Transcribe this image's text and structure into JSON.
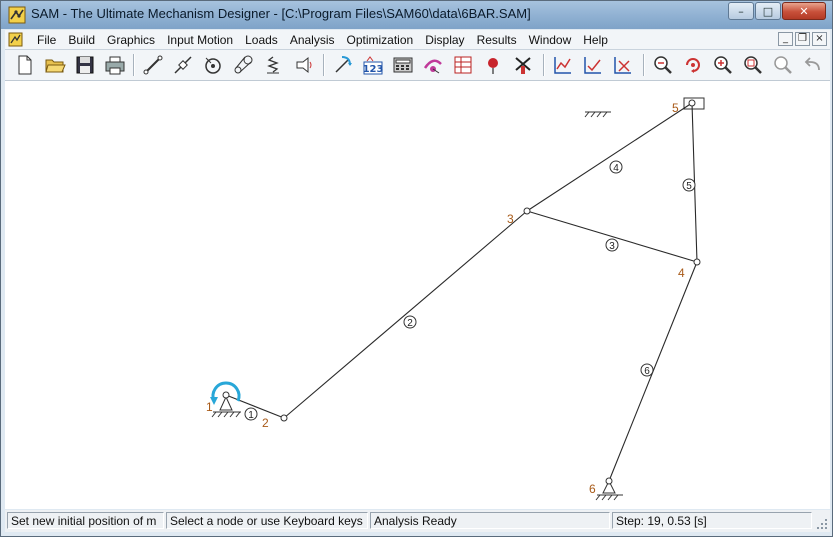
{
  "window": {
    "title": "SAM - The Ultimate Mechanism Designer - [C:\\Program Files\\SAM60\\data\\6BAR.SAM]",
    "caption_buttons": {
      "minimize": "–",
      "maximize": "□",
      "close": "✕"
    }
  },
  "menubar": {
    "items": [
      "File",
      "Build",
      "Graphics",
      "Input Motion",
      "Loads",
      "Analysis",
      "Optimization",
      "Display",
      "Results",
      "Window",
      "Help"
    ],
    "mdi_buttons": {
      "minimize": "_",
      "restore": "❐",
      "close": "×"
    }
  },
  "toolbar": {
    "buttons": [
      "new-file-icon",
      "open-folder-icon",
      "save-disk-icon",
      "print-icon",
      "beam-element-icon",
      "slider-element-icon",
      "gear-element-icon",
      "belt-element-icon",
      "spring-element-icon",
      "damper-element-icon",
      "input-motion-icon",
      "numeric-input-icon",
      "calculator-icon",
      "path-tracer-icon",
      "table-icon",
      "pin-marker-icon",
      "windmill-icon",
      "graph-xy-icon",
      "graph-check-icon",
      "graph-cross-icon",
      "zoom-out-icon",
      "zoom-rotate-icon",
      "zoom-in-icon",
      "zoom-window-icon",
      "zoom-fit-icon",
      "undo-icon"
    ]
  },
  "mechanism": {
    "node_labels": [
      "1",
      "2",
      "3",
      "4",
      "5",
      "6"
    ],
    "link_labels": [
      "1",
      "2",
      "3",
      "4",
      "5",
      "6"
    ]
  },
  "statusbar": {
    "hint": "Set new initial position of m",
    "prompt": "Select a node or use Keyboard keys",
    "state": "Analysis Ready",
    "step": "Step: 19,    0.53 [s]"
  },
  "colors": {
    "node_label": "#a85a18",
    "link_line": "#2a2a2a",
    "input_arrow": "#28a7d8",
    "title_bar": "#8fb0d2"
  }
}
